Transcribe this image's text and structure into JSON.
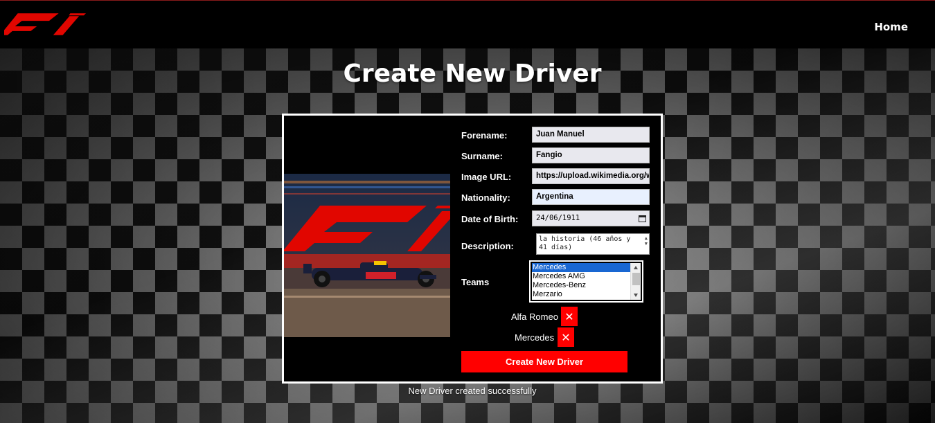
{
  "nav": {
    "home_label": "Home"
  },
  "page": {
    "title": "Create New Driver"
  },
  "form": {
    "forename": {
      "label": "Forename:",
      "value": "Juan Manuel"
    },
    "surname": {
      "label": "Surname:",
      "value": "Fangio"
    },
    "image_url": {
      "label": "Image URL:",
      "value": "https://upload.wikimedia.org/wi"
    },
    "nationality": {
      "label": "Nationality:",
      "value": "Argentina"
    },
    "dob": {
      "label": "Date of Birth:",
      "value": "24/06/1911"
    },
    "description": {
      "label": "Description:",
      "value_line1": "la historia (46 años y",
      "value_line2": "41 días)"
    },
    "teams": {
      "label": "Teams",
      "options": [
        "Mercedes",
        "Mercedes AMG",
        "Mercedes-Benz",
        "Merzario"
      ],
      "selected": "Mercedes"
    },
    "selected_teams": [
      "Alfa Romeo",
      "Mercedes"
    ],
    "remove_glyph": "✕",
    "submit_label": "Create New Driver"
  },
  "status": {
    "message": "New Driver created successfully"
  },
  "colors": {
    "accent": "#ff0000",
    "navbar": "#000000",
    "card_border": "#ffffff",
    "select_highlight": "#1967d2"
  },
  "icons": {
    "logo": "f1-logo",
    "calendar": "calendar-icon",
    "remove": "close-icon"
  }
}
